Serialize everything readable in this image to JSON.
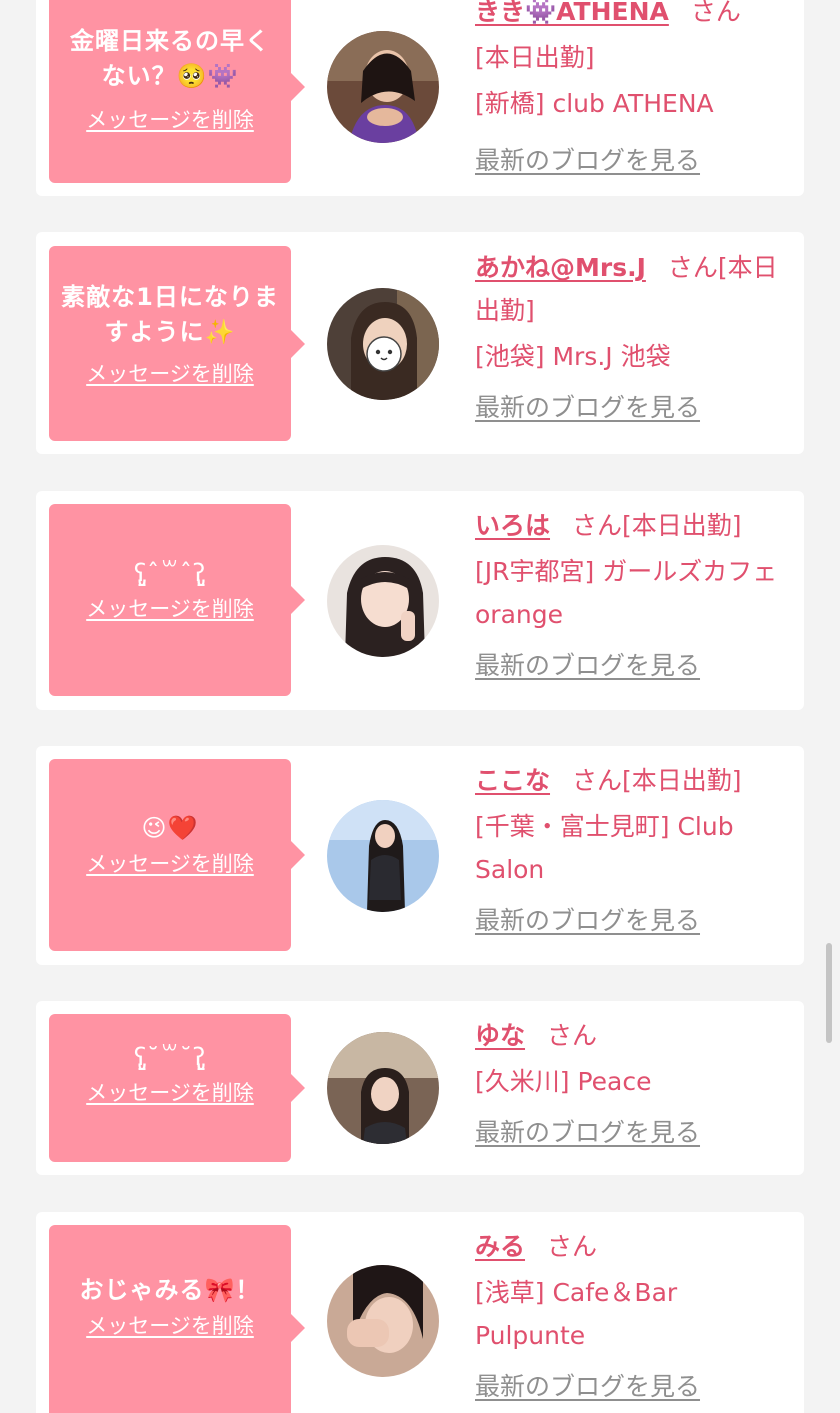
{
  "delete_label": "メッセージを削除",
  "blog_label": "最新のブログを見る",
  "colors": {
    "background": "#f3f3f3",
    "card": "#ffffff",
    "bubble": "#ff93a3",
    "accent_text": "#e0506e",
    "link_gray": "#8f8f8f"
  },
  "cards": [
    {
      "message": "金曜日来るの早くない？🥺👾",
      "name": "きき👾ATHENA",
      "san": "さん",
      "line2": "[本日出勤]",
      "line3": "[新橋] club ATHENA",
      "avatar_icon": "photo-avatar"
    },
    {
      "message": "素敵な1日になりますように✨",
      "name": "あかね@Mrs.J",
      "san": "さん[本日出勤]",
      "line2": "[池袋] Mrs.J 池袋",
      "avatar_icon": "photo-avatar"
    },
    {
      "message": "ʕ̡̢̡ˆ꒳ˆʔ̢̡̢",
      "name": "いろは",
      "san": "さん[本日出勤]",
      "line2": "[JR宇都宮] ガールズカフェ orange",
      "avatar_icon": "photo-avatar"
    },
    {
      "message": "😉❤️",
      "name": "ここな",
      "san": "さん[本日出勤]",
      "line2": "[千葉・富士見町] Club Salon",
      "avatar_icon": "photo-avatar"
    },
    {
      "message": "ʕ̡̢̡˘꒳˘ʔ̢̡̢",
      "name": "ゆな",
      "san": "さん",
      "line2": "[久米川] Peace",
      "avatar_icon": "photo-avatar"
    },
    {
      "message": "おじゃみる🎀！",
      "name": "みる",
      "san": "さん",
      "line2": "[浅草] Cafe＆Bar Pulpunte",
      "avatar_icon": "photo-avatar"
    }
  ]
}
